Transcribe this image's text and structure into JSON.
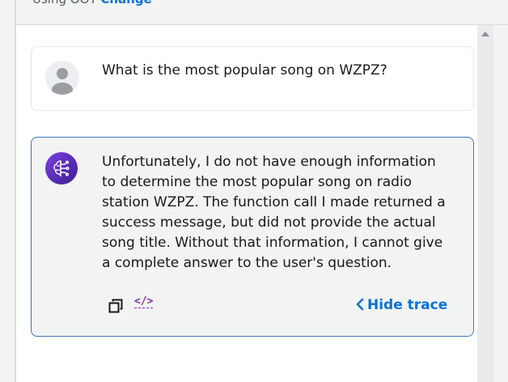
{
  "header": {
    "using_text": "Using OOT",
    "change_link": "Change"
  },
  "conversation": {
    "user_message": "What is the most popular song on WZPZ?",
    "bot_message": "Unfortunately, I do not have enough information to determine the most popular song on radio station WZPZ. The function call I made returned a success message, but did not provide the actual song title. Without that information, I cannot give a complete answer to the user's question."
  },
  "actions": {
    "code_label": "</>",
    "hide_trace_label": "Hide trace"
  },
  "icons": {
    "user_avatar": "user-avatar-icon",
    "bot_avatar": "brain-circuit-icon",
    "copy": "copy-icon",
    "code": "code-icon",
    "chevron": "chevron-left-icon"
  },
  "colors": {
    "accent": "#0972d3",
    "card_border": "#3d77b5",
    "bot_avatar": "#5a2fbf",
    "code_icon": "#7d2ea8"
  }
}
